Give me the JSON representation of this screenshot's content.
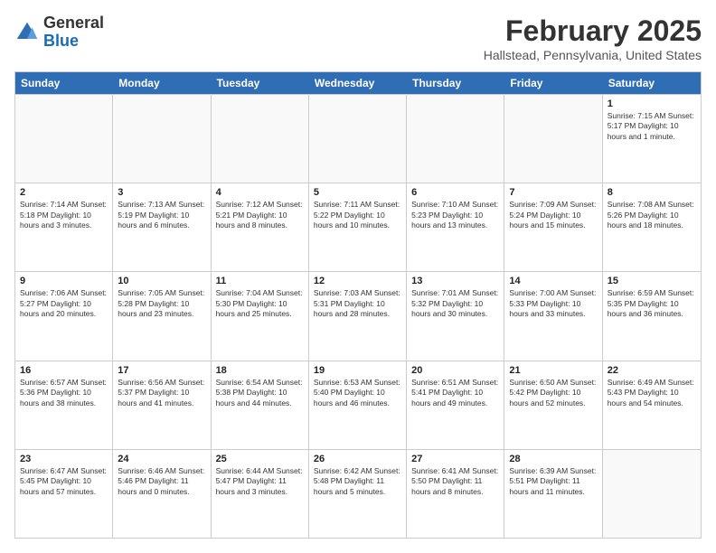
{
  "header": {
    "logo_line1": "General",
    "logo_line2": "Blue",
    "month": "February 2025",
    "location": "Hallstead, Pennsylvania, United States"
  },
  "days_of_week": [
    "Sunday",
    "Monday",
    "Tuesday",
    "Wednesday",
    "Thursday",
    "Friday",
    "Saturday"
  ],
  "rows": [
    [
      {
        "day": "",
        "info": ""
      },
      {
        "day": "",
        "info": ""
      },
      {
        "day": "",
        "info": ""
      },
      {
        "day": "",
        "info": ""
      },
      {
        "day": "",
        "info": ""
      },
      {
        "day": "",
        "info": ""
      },
      {
        "day": "1",
        "info": "Sunrise: 7:15 AM\nSunset: 5:17 PM\nDaylight: 10 hours\nand 1 minute."
      }
    ],
    [
      {
        "day": "2",
        "info": "Sunrise: 7:14 AM\nSunset: 5:18 PM\nDaylight: 10 hours\nand 3 minutes."
      },
      {
        "day": "3",
        "info": "Sunrise: 7:13 AM\nSunset: 5:19 PM\nDaylight: 10 hours\nand 6 minutes."
      },
      {
        "day": "4",
        "info": "Sunrise: 7:12 AM\nSunset: 5:21 PM\nDaylight: 10 hours\nand 8 minutes."
      },
      {
        "day": "5",
        "info": "Sunrise: 7:11 AM\nSunset: 5:22 PM\nDaylight: 10 hours\nand 10 minutes."
      },
      {
        "day": "6",
        "info": "Sunrise: 7:10 AM\nSunset: 5:23 PM\nDaylight: 10 hours\nand 13 minutes."
      },
      {
        "day": "7",
        "info": "Sunrise: 7:09 AM\nSunset: 5:24 PM\nDaylight: 10 hours\nand 15 minutes."
      },
      {
        "day": "8",
        "info": "Sunrise: 7:08 AM\nSunset: 5:26 PM\nDaylight: 10 hours\nand 18 minutes."
      }
    ],
    [
      {
        "day": "9",
        "info": "Sunrise: 7:06 AM\nSunset: 5:27 PM\nDaylight: 10 hours\nand 20 minutes."
      },
      {
        "day": "10",
        "info": "Sunrise: 7:05 AM\nSunset: 5:28 PM\nDaylight: 10 hours\nand 23 minutes."
      },
      {
        "day": "11",
        "info": "Sunrise: 7:04 AM\nSunset: 5:30 PM\nDaylight: 10 hours\nand 25 minutes."
      },
      {
        "day": "12",
        "info": "Sunrise: 7:03 AM\nSunset: 5:31 PM\nDaylight: 10 hours\nand 28 minutes."
      },
      {
        "day": "13",
        "info": "Sunrise: 7:01 AM\nSunset: 5:32 PM\nDaylight: 10 hours\nand 30 minutes."
      },
      {
        "day": "14",
        "info": "Sunrise: 7:00 AM\nSunset: 5:33 PM\nDaylight: 10 hours\nand 33 minutes."
      },
      {
        "day": "15",
        "info": "Sunrise: 6:59 AM\nSunset: 5:35 PM\nDaylight: 10 hours\nand 36 minutes."
      }
    ],
    [
      {
        "day": "16",
        "info": "Sunrise: 6:57 AM\nSunset: 5:36 PM\nDaylight: 10 hours\nand 38 minutes."
      },
      {
        "day": "17",
        "info": "Sunrise: 6:56 AM\nSunset: 5:37 PM\nDaylight: 10 hours\nand 41 minutes."
      },
      {
        "day": "18",
        "info": "Sunrise: 6:54 AM\nSunset: 5:38 PM\nDaylight: 10 hours\nand 44 minutes."
      },
      {
        "day": "19",
        "info": "Sunrise: 6:53 AM\nSunset: 5:40 PM\nDaylight: 10 hours\nand 46 minutes."
      },
      {
        "day": "20",
        "info": "Sunrise: 6:51 AM\nSunset: 5:41 PM\nDaylight: 10 hours\nand 49 minutes."
      },
      {
        "day": "21",
        "info": "Sunrise: 6:50 AM\nSunset: 5:42 PM\nDaylight: 10 hours\nand 52 minutes."
      },
      {
        "day": "22",
        "info": "Sunrise: 6:49 AM\nSunset: 5:43 PM\nDaylight: 10 hours\nand 54 minutes."
      }
    ],
    [
      {
        "day": "23",
        "info": "Sunrise: 6:47 AM\nSunset: 5:45 PM\nDaylight: 10 hours\nand 57 minutes."
      },
      {
        "day": "24",
        "info": "Sunrise: 6:46 AM\nSunset: 5:46 PM\nDaylight: 11 hours\nand 0 minutes."
      },
      {
        "day": "25",
        "info": "Sunrise: 6:44 AM\nSunset: 5:47 PM\nDaylight: 11 hours\nand 3 minutes."
      },
      {
        "day": "26",
        "info": "Sunrise: 6:42 AM\nSunset: 5:48 PM\nDaylight: 11 hours\nand 5 minutes."
      },
      {
        "day": "27",
        "info": "Sunrise: 6:41 AM\nSunset: 5:50 PM\nDaylight: 11 hours\nand 8 minutes."
      },
      {
        "day": "28",
        "info": "Sunrise: 6:39 AM\nSunset: 5:51 PM\nDaylight: 11 hours\nand 11 minutes."
      },
      {
        "day": "",
        "info": ""
      }
    ]
  ]
}
